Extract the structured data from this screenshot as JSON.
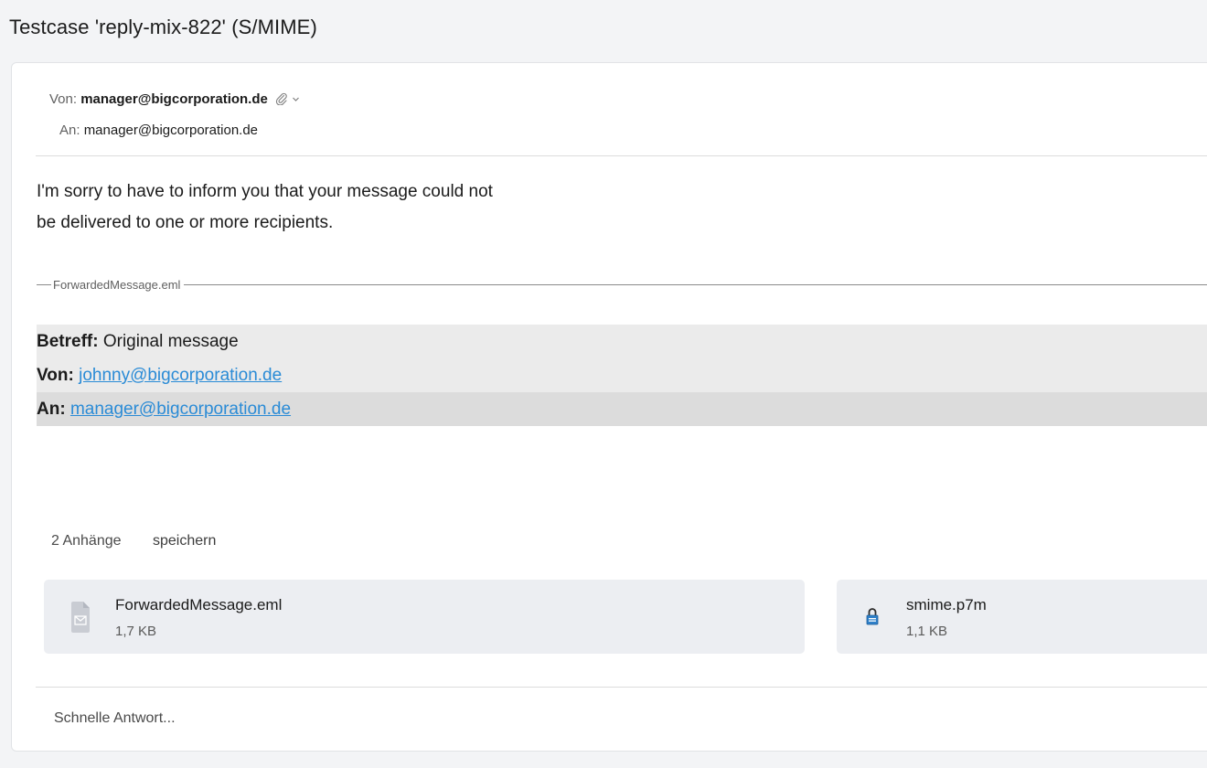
{
  "subject": "Testcase 'reply-mix-822' (S/MIME)",
  "header": {
    "from_label": "Von:",
    "from_address": "manager@bigcorporation.de",
    "to_label": "An:",
    "to_address": "manager@bigcorporation.de",
    "icons": [
      "attachment-icon",
      "chevron-down-icon"
    ]
  },
  "body": {
    "line1": "I'm sorry to have to inform you that your message could not",
    "line2": "be delivered to one or more recipients."
  },
  "forwarded": {
    "separator_label": "ForwardedMessage.eml",
    "subject_label": "Betreff:",
    "subject_value": "Original message",
    "from_label": "Von:",
    "from_value": "johnny@bigcorporation.de",
    "to_label": "An:",
    "to_value": "manager@bigcorporation.de"
  },
  "attachments": {
    "count_label": "2 Anhänge",
    "save_label": "speichern",
    "items": [
      {
        "name": "ForwardedMessage.eml",
        "size": "1,7 KB",
        "icon": "mail-file-icon"
      },
      {
        "name": "smime.p7m",
        "size": "1,1 KB",
        "icon": "lock-file-icon"
      }
    ]
  },
  "quick_reply": {
    "placeholder": "Schnelle Antwort..."
  },
  "colors": {
    "page_bg": "#f3f4f6",
    "link": "#2a8bd6",
    "tile_bg": "#eceef2",
    "fw_row_light": "#ebebeb",
    "fw_row_dark": "#dcdcdc"
  }
}
